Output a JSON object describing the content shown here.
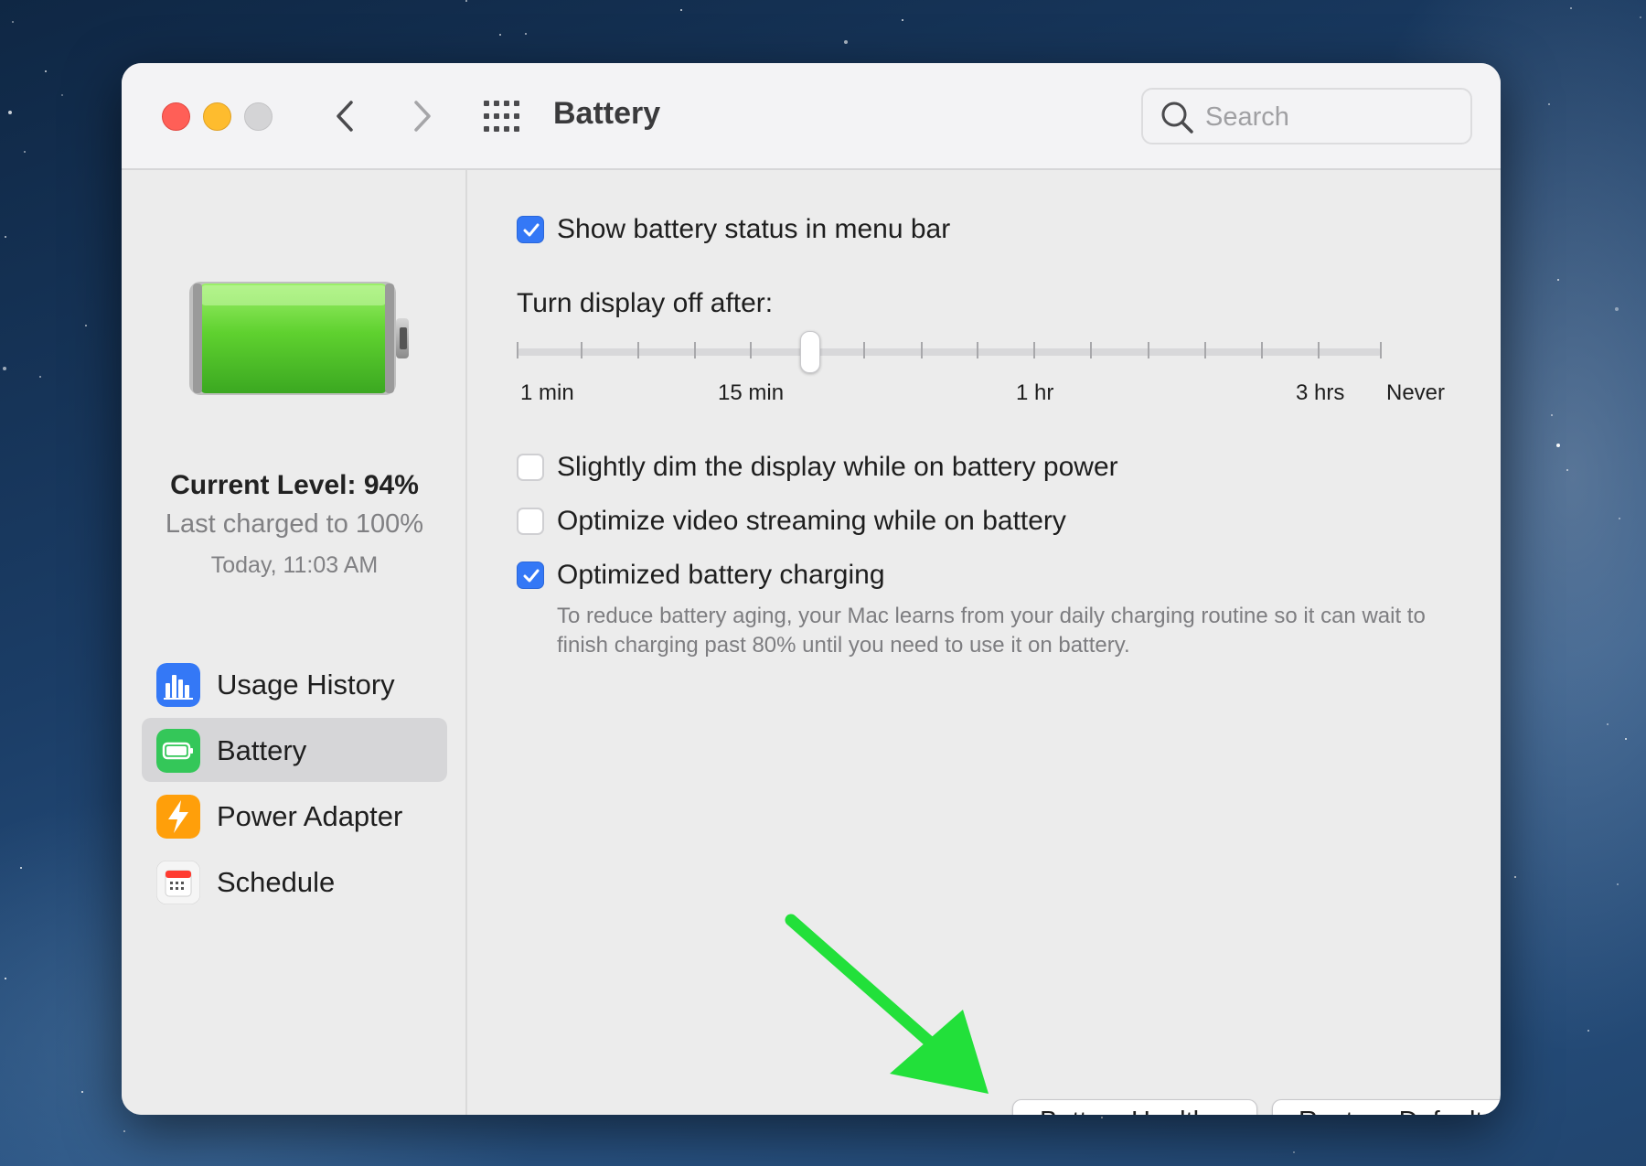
{
  "window": {
    "title": "Battery",
    "traffic_lights": [
      "close",
      "minimize",
      "zoom"
    ],
    "search": {
      "placeholder": "Search"
    }
  },
  "sidebar": {
    "current_level": "Current Level: 94%",
    "last_charged": "Last charged to 100%",
    "last_charged_time": "Today, 11:03 AM",
    "items": [
      {
        "label": "Usage History",
        "icon": "bar-chart-icon",
        "color": "#3478f6",
        "selected": false
      },
      {
        "label": "Battery",
        "icon": "battery-icon",
        "color": "#34c759",
        "selected": true
      },
      {
        "label": "Power Adapter",
        "icon": "lightning-icon",
        "color": "#ff9f0a",
        "selected": false
      },
      {
        "label": "Schedule",
        "icon": "calendar-icon",
        "color": "#ffffff",
        "selected": false
      }
    ]
  },
  "main": {
    "show_status": {
      "label": "Show battery status in menu bar",
      "checked": true
    },
    "display_off": {
      "label": "Turn display off after:",
      "slider_labels": [
        "1 min",
        "15 min",
        "1 hr",
        "3 hrs",
        "Never"
      ],
      "value": "15 min"
    },
    "dim_display": {
      "label": "Slightly dim the display while on battery power",
      "checked": false
    },
    "video_streaming": {
      "label": "Optimize video streaming while on battery",
      "checked": false
    },
    "optimized_charging": {
      "label": "Optimized battery charging",
      "checked": true,
      "description": "To reduce battery aging, your Mac learns from your daily charging routine so it can wait to finish charging past 80% until you need to use it on battery."
    },
    "buttons": {
      "battery_health": "Battery Health...",
      "restore_defaults": "Restore Defaults",
      "help": "?"
    }
  },
  "colors": {
    "accent": "#3478f6",
    "battery_green": "#4cd137",
    "annotation_arrow": "#22e03a"
  }
}
